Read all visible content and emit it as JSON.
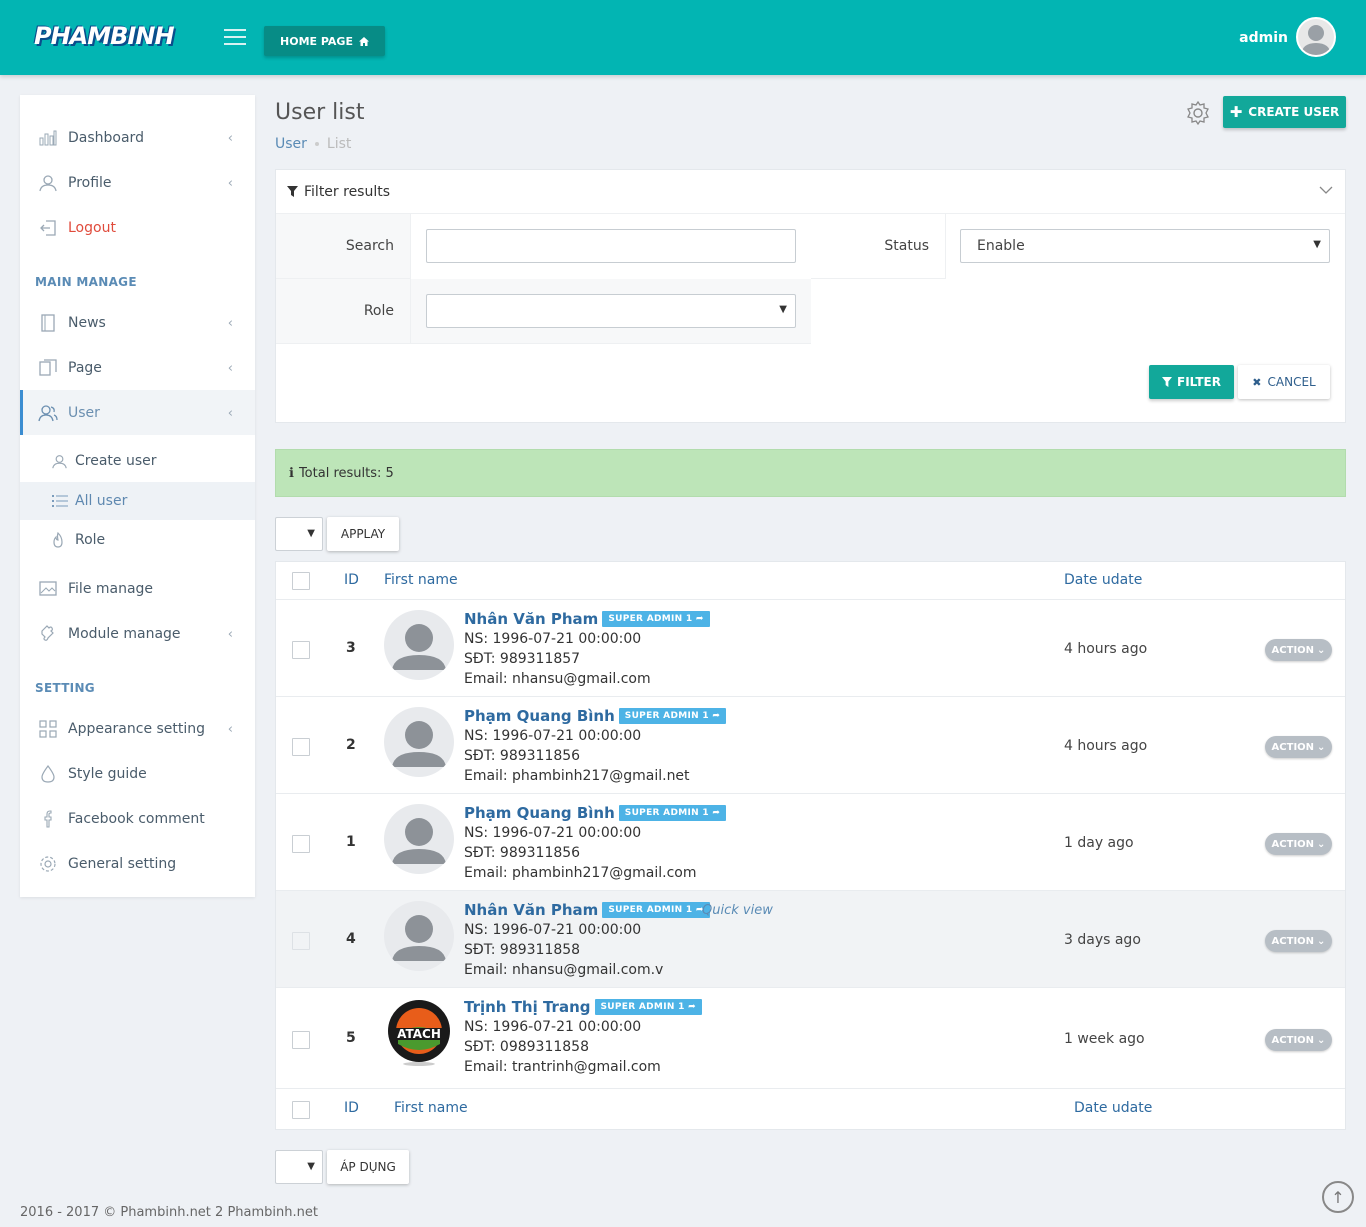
{
  "header": {
    "logo": "PHAMBINH",
    "home_label": "HOME PAGE",
    "admin_name": "admin"
  },
  "sidebar": {
    "items": [
      {
        "label": "Dashboard",
        "icon": "bar-chart-icon"
      },
      {
        "label": "Profile",
        "icon": "user-icon"
      },
      {
        "label": "Logout",
        "icon": "logout-icon"
      }
    ],
    "section_main": "MAIN MANAGE",
    "main_items": [
      {
        "label": "News",
        "icon": "book-icon"
      },
      {
        "label": "Page",
        "icon": "pages-icon"
      },
      {
        "label": "User",
        "icon": "users-icon"
      }
    ],
    "user_sub": [
      {
        "label": "Create user",
        "icon": "user-icon"
      },
      {
        "label": "All user",
        "icon": "list-icon"
      },
      {
        "label": "Role",
        "icon": "fire-icon"
      }
    ],
    "more_items": [
      {
        "label": "File manage",
        "icon": "image-icon"
      },
      {
        "label": "Module manage",
        "icon": "puzzle-icon"
      }
    ],
    "section_setting": "SETTING",
    "setting_items": [
      {
        "label": "Appearance setting",
        "icon": "grid-icon"
      },
      {
        "label": "Style guide",
        "icon": "drop-icon"
      },
      {
        "label": "Facebook comment",
        "icon": "facebook-icon"
      },
      {
        "label": "General setting",
        "icon": "gear-icon"
      }
    ]
  },
  "page": {
    "title": "User list",
    "breadcrumb": [
      "User",
      "List"
    ],
    "create_label": "CREATE USER"
  },
  "filter": {
    "title": "Filter results",
    "search_label": "Search",
    "search_value": "",
    "status_label": "Status",
    "status_value": "Enable",
    "role_label": "Role",
    "role_value": "",
    "filter_label": "FILTER",
    "cancel_label": "CANCEL"
  },
  "alert": {
    "text": "Total results: 5"
  },
  "bulk": {
    "apply_top": "APPLAY",
    "apply_bottom": "ÁP DỤNG"
  },
  "table": {
    "headers": {
      "id": "ID",
      "first_name": "First name",
      "date": "Date udate"
    },
    "badge": "SUPER ADMIN 1",
    "action_label": "ACTION",
    "quick_view": "Quick view",
    "rows": [
      {
        "id": "3",
        "name": "Nhân Văn Pham",
        "ns": "NS: 1996-07-21 00:00:00",
        "sdt": "SĐT: 989311857",
        "email": "Email: nhansu@gmail.com",
        "date": "4 hours ago"
      },
      {
        "id": "2",
        "name": "Phạm Quang Bình",
        "ns": "NS: 1996-07-21 00:00:00",
        "sdt": "SĐT: 989311856",
        "email": "Email: phambinh217@gmail.net",
        "date": "4 hours ago"
      },
      {
        "id": "1",
        "name": "Phạm Quang Bình",
        "ns": "NS: 1996-07-21 00:00:00",
        "sdt": "SĐT: 989311856",
        "email": "Email: phambinh217@gmail.com",
        "date": "1 day ago"
      },
      {
        "id": "4",
        "name": "Nhân Văn Pham",
        "ns": "NS: 1996-07-21 00:00:00",
        "sdt": "SĐT: 989311858",
        "email": "Email: nhansu@gmail.com.v",
        "date": "3 days ago"
      },
      {
        "id": "5",
        "name": "Trịnh Thị Trang",
        "ns": "NS: 1996-07-21 00:00:00",
        "sdt": "SĐT: 0989311858",
        "email": "Email: trantrinh@gmail.com",
        "date": "1 week ago"
      }
    ]
  },
  "footer": {
    "text": "2016 - 2017 © Phambinh.net 2 Phambinh.net"
  },
  "colors": {
    "primary": "#02b5b3",
    "button": "#12a89a",
    "link": "#2e6aa0",
    "badge": "#4db3e6",
    "alert": "#bde5b8"
  }
}
